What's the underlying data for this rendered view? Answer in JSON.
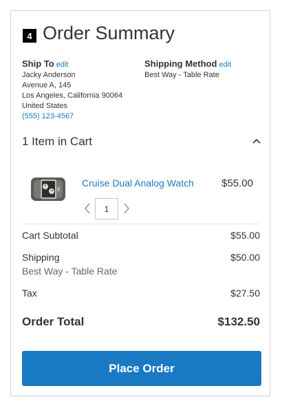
{
  "summary": {
    "step_number": "4",
    "title": "Order Summary"
  },
  "ship_to": {
    "heading": "Ship To",
    "edit_label": "edit",
    "name": "Jacky Anderson",
    "street": "Avenue A, 145",
    "city_line": "Los Angeles, California 90064",
    "country": "United States",
    "phone": "(555) 123-4567"
  },
  "shipping_method": {
    "heading": "Shipping Method",
    "edit_label": "edit",
    "value": "Best Way - Table Rate"
  },
  "cart": {
    "items_heading": "1 Item in Cart",
    "toggle_icon": "chevron-up-icon",
    "item": {
      "name": "Cruise Dual Analog Watch",
      "price": "$55.00",
      "quantity": "1",
      "thumbnail_icon": "watch-thumbnail"
    }
  },
  "totals": {
    "subtotal_label": "Cart Subtotal",
    "subtotal_value": "$55.00",
    "shipping_label": "Shipping",
    "shipping_method": "Best Way - Table Rate",
    "shipping_value": "$50.00",
    "tax_label": "Tax",
    "tax_value": "$27.50",
    "order_total_label": "Order Total",
    "order_total_value": "$132.50"
  },
  "actions": {
    "place_order_label": "Place Order"
  },
  "colors": {
    "accent": "#1979c3",
    "text": "#333333",
    "border": "#d1d1d1"
  }
}
